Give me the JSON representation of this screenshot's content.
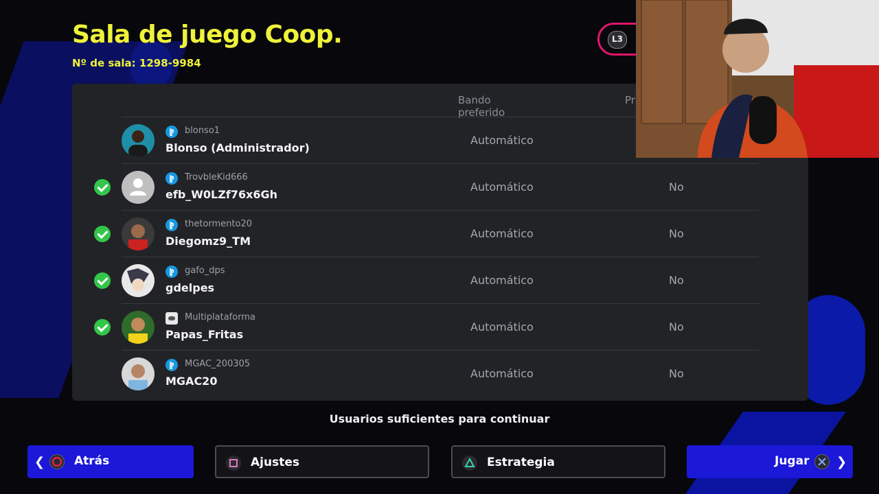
{
  "header": {
    "title": "Sala de juego Coop.",
    "room_number": "Nº de sala: 1298-9984",
    "toggle_button": "L3"
  },
  "table": {
    "columns": {
      "side": "Bando preferido",
      "pref": "Pr"
    },
    "rows": [
      {
        "ready": false,
        "psn": "blonso1",
        "platform": "playstation",
        "name": "Blonso (Administrador)",
        "side": "Automático",
        "pref": ""
      },
      {
        "ready": true,
        "psn": "TrovbleKid666",
        "platform": "playstation",
        "name": "efb_W0LZf76x6Gh",
        "side": "Automático",
        "pref": "No"
      },
      {
        "ready": true,
        "psn": "thetormento20",
        "platform": "playstation",
        "name": "Diegomz9_TM",
        "side": "Automático",
        "pref": "No"
      },
      {
        "ready": true,
        "psn": "gafo_dps",
        "platform": "playstation",
        "name": "gdelpes",
        "side": "Automático",
        "pref": "No"
      },
      {
        "ready": true,
        "psn": "Multiplataforma",
        "platform": "multi",
        "name": "Papas_Fritas",
        "side": "Automático",
        "pref": "No"
      },
      {
        "ready": false,
        "psn": "MGAC_200305",
        "platform": "playstation",
        "name": "MGAC20",
        "side": "Automático",
        "pref": "No"
      }
    ]
  },
  "status": "Usuarios suficientes para continuar",
  "footer": {
    "back": "Atrás",
    "settings": "Ajustes",
    "strategy": "Estrategia",
    "play": "Jugar"
  },
  "colors": {
    "title": "#eef23a",
    "accent_blue": "#1b18d8",
    "ready_green": "#33c64a",
    "l3_border": "#e0166a"
  }
}
